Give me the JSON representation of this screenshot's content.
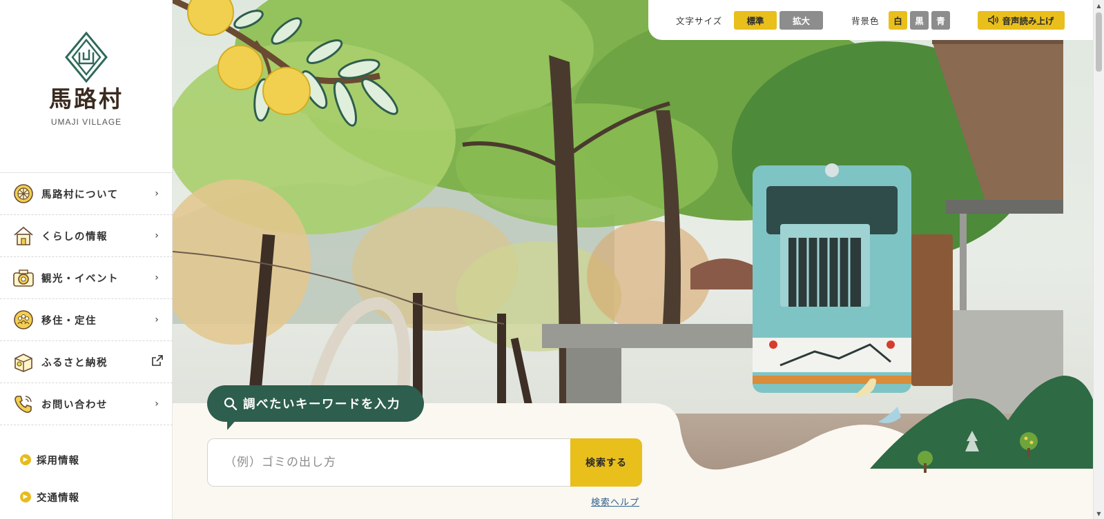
{
  "colors": {
    "accent_yellow": "#e9bf1c",
    "forest_green": "#2e5e4d",
    "cream": "#fbf8f1",
    "link_blue": "#2f5f8e"
  },
  "logo": {
    "name": "馬路村",
    "subtitle": "UMAJI VILLAGE"
  },
  "menu": [
    {
      "label": "馬路村について",
      "icon": "yuzu-icon",
      "arrow": "›"
    },
    {
      "label": "くらしの情報",
      "icon": "house-icon",
      "arrow": "›"
    },
    {
      "label": "観光・イベント",
      "icon": "camera-icon",
      "arrow": "›"
    },
    {
      "label": "移住・定住",
      "icon": "people-icon",
      "arrow": "›"
    },
    {
      "label": "ふるさと納税",
      "icon": "gift-box-icon",
      "arrow": "external-link-icon"
    },
    {
      "label": "お問い合わせ",
      "icon": "phone-icon",
      "arrow": "›"
    }
  ],
  "sublinks": [
    {
      "label": "採用情報"
    },
    {
      "label": "交通情報"
    }
  ],
  "toolbar": {
    "font_size_label": "文字サイズ",
    "font_standard": "標準",
    "font_large": "拡大",
    "bg_color_label": "背景色",
    "bg_white": "白",
    "bg_black": "黒",
    "bg_blue": "青",
    "read_aloud": "音声読み上げ"
  },
  "search": {
    "heading": "調べたいキーワードを入力",
    "placeholder": "（例）ゴミの出し方",
    "button": "検索する",
    "help": "検索ヘルプ"
  }
}
